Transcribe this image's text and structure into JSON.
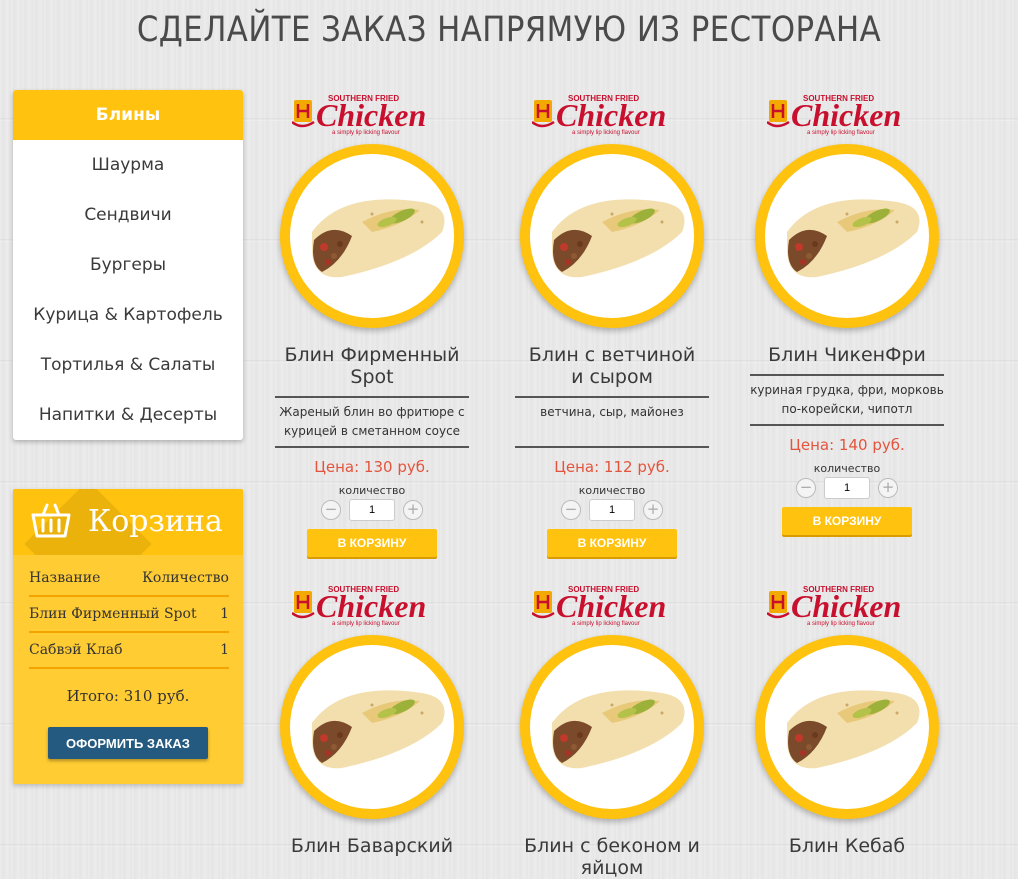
{
  "page_title": "СДЕЛАЙТЕ ЗАКАЗ НАПРЯМУЮ ИЗ РЕСТОРАНА",
  "colors": {
    "accent": "#ffc20e",
    "price": "#e4543c",
    "order_button": "#245a80",
    "logo_red": "#c8102e"
  },
  "menu": {
    "items": [
      {
        "label": "Блины",
        "active": true
      },
      {
        "label": "Шаурма"
      },
      {
        "label": "Сендвичи"
      },
      {
        "label": "Бургеры"
      },
      {
        "label": "Курица & Картофель"
      },
      {
        "label": "Тортилья & Салаты"
      },
      {
        "label": "Напитки & Десерты"
      }
    ]
  },
  "cart": {
    "title": "Корзина",
    "col_name": "Название",
    "col_qty": "Количество",
    "rows": [
      {
        "name": "Блин Фирменный Spot",
        "qty": "1"
      },
      {
        "name": "Сабвэй Клаб",
        "qty": "1"
      }
    ],
    "total": "Итого: 310 руб.",
    "order_label": "ОФОРМИТЬ ЗАКАЗ"
  },
  "logo": {
    "brand": "Chicken",
    "top_text": "SOUTHERN FRIED",
    "tagline": "a simply lip licking flavour"
  },
  "products": [
    {
      "name": "Блин Фирменный Spot",
      "desc": "Жареный блин во фритюре с курицей в сметанном соусе",
      "price": "Цена: 130 руб.",
      "qty_label": "количество",
      "qty": "1",
      "add_label": "В КОРЗИНУ"
    },
    {
      "name": "Блин с ветчиной и сыром",
      "desc": "ветчина, сыр, майонез",
      "price": "Цена: 112 руб.",
      "qty_label": "количество",
      "qty": "1",
      "add_label": "В КОРЗИНУ"
    },
    {
      "name": "Блин ЧикенФри",
      "desc": "куриная грудка, фри, морковь по-корейски, чипотл",
      "price": "Цена: 140 руб.",
      "qty_label": "количество",
      "qty": "1",
      "add_label": "В КОРЗИНУ"
    },
    {
      "name": "Блин Баварский"
    },
    {
      "name": "Блин с беконом и яйцом"
    },
    {
      "name": "Блин Кебаб"
    }
  ]
}
